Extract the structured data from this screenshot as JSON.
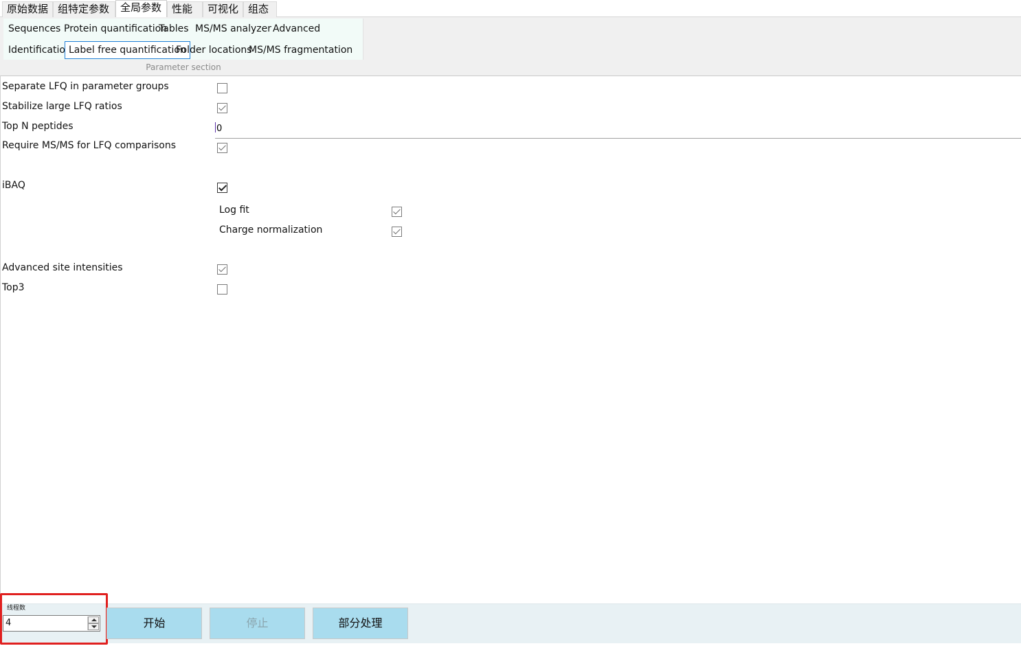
{
  "top_tabs": [
    {
      "label": "原始数据",
      "active": false
    },
    {
      "label": "组特定参数",
      "active": false
    },
    {
      "label": "全局参数",
      "active": true
    },
    {
      "label": "性能",
      "active": false
    },
    {
      "label": "可视化",
      "active": false
    },
    {
      "label": "组态",
      "active": false
    }
  ],
  "param_tabs": {
    "row1": [
      "Sequences",
      "Protein quantification",
      "Tables",
      "MS/MS analyzer",
      "Advanced"
    ],
    "row2": [
      "Identification",
      "Label free quantification",
      "Folder locations",
      "MS/MS fragmentation"
    ],
    "active": "Label free quantification",
    "caption": "Parameter section"
  },
  "settings": {
    "separate_lfq": {
      "label": "Separate LFQ in parameter groups",
      "checked": false
    },
    "stabilize_lfq": {
      "label": "Stabilize large LFQ ratios",
      "checked": true
    },
    "top_n": {
      "label": "Top N peptides",
      "value": "0"
    },
    "require_msms": {
      "label": "Require MS/MS for LFQ comparisons",
      "checked": true
    },
    "ibaq": {
      "label": "iBAQ",
      "checked": true
    },
    "log_fit": {
      "label": "Log fit",
      "checked": true
    },
    "charge_norm": {
      "label": "Charge normalization",
      "checked": true
    },
    "adv_site": {
      "label": "Advanced site intensities",
      "checked": true
    },
    "top3": {
      "label": "Top3",
      "checked": false
    }
  },
  "bottom": {
    "threads_label": "线程数",
    "threads_value": "4",
    "start_label": "开始",
    "stop_label": "停止",
    "partial_label": "部分处理"
  },
  "colors": {
    "highlight": "#e0201f",
    "button_bg": "#a9dcee",
    "active_tab_border": "#1f7ed6"
  }
}
